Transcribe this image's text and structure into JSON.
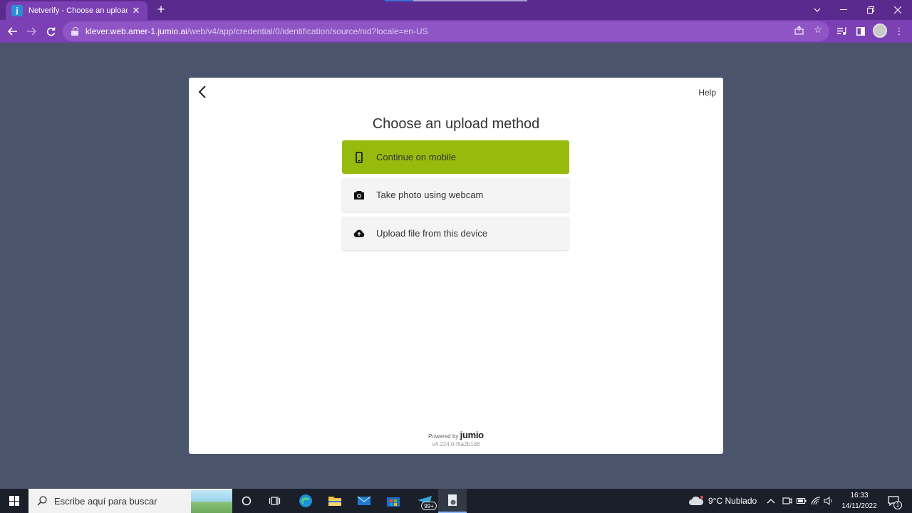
{
  "browser": {
    "tab_title": "Netverify - Choose an upload m",
    "tab_favicon_letter": "j",
    "new_tab_icon": "+",
    "url_host": "klever.web.amer-1.jumio.ai",
    "url_path": "/web/v4/app/credential/0/identification/source/nid?locale=en-US",
    "colors": {
      "frame": "#5b2a8e",
      "toolbar": "#7a40b4"
    }
  },
  "page": {
    "help_label": "Help",
    "heading": "Choose an upload method",
    "options": [
      {
        "label": "Continue on mobile",
        "icon": "smartphone-icon",
        "primary": true
      },
      {
        "label": "Take photo using webcam",
        "icon": "camera-icon",
        "primary": false
      },
      {
        "label": "Upload file from this device",
        "icon": "cloud-upload-icon",
        "primary": false
      }
    ],
    "powered_by": "Powered by",
    "brand": "jumio",
    "version": "v4.224.0-f5a2b1d8",
    "colors": {
      "primary": "#97bb0c",
      "background": "#4a556b"
    }
  },
  "taskbar": {
    "search_placeholder": "Escribe aquí para buscar",
    "badge": "99+",
    "weather": "9°C  Nublado",
    "time": "16:33",
    "date": "14/11/2022",
    "notification_count": "1"
  }
}
